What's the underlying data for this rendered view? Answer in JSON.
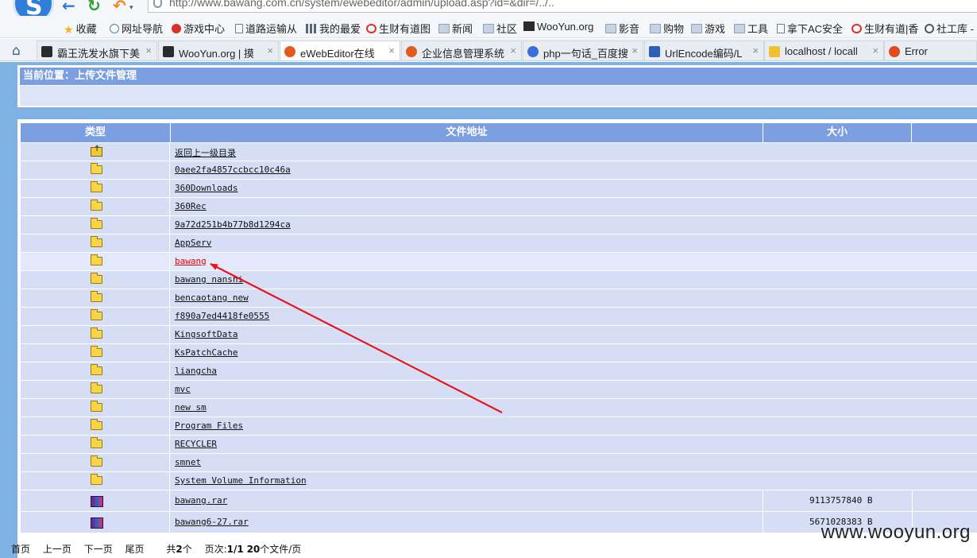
{
  "browser": {
    "logo_letter": "S",
    "url": "http://www.bawang.com.cn/system/ewebeditor/admin/upload.asp?id=&dir=/../..",
    "bookmarks": [
      {
        "label": "收藏",
        "icon": "star-icon"
      },
      {
        "label": "网址导航",
        "icon": "globe-icon"
      },
      {
        "label": "游戏中心",
        "icon": "game-icon"
      },
      {
        "label": "道路运输从",
        "icon": "page-icon"
      },
      {
        "label": "我的最爱",
        "icon": "grid-icon"
      },
      {
        "label": "生财有道图",
        "icon": "chrome-icon"
      },
      {
        "label": "新闻",
        "icon": "folder-icon"
      },
      {
        "label": "社区",
        "icon": "folder-icon"
      },
      {
        "label": "WooYun.org",
        "icon": "wooyun-icon"
      },
      {
        "label": "影音",
        "icon": "folder-icon"
      },
      {
        "label": "购物",
        "icon": "folder-icon"
      },
      {
        "label": "游戏",
        "icon": "folder-icon"
      },
      {
        "label": "工具",
        "icon": "folder-icon"
      },
      {
        "label": "拿下AC安全",
        "icon": "page-icon"
      },
      {
        "label": "生财有道|香",
        "icon": "chrome-icon"
      },
      {
        "label": "社工库 -",
        "icon": "search-icon"
      }
    ],
    "tabs": [
      {
        "label": "霸王洗发水旗下美",
        "icon": "dark"
      },
      {
        "label": "WooYun.org | 摸",
        "icon": "dark"
      },
      {
        "label": "eWebEditor在线",
        "icon": "red",
        "active": true
      },
      {
        "label": "企业信息管理系统",
        "icon": "red"
      },
      {
        "label": "php一句话_百度搜",
        "icon": "paw"
      },
      {
        "label": "UrlEncode编码/L",
        "icon": "uenc"
      },
      {
        "label": "localhost / locall",
        "icon": "pma"
      },
      {
        "label": "Error",
        "icon": "err"
      }
    ]
  },
  "location": {
    "title": "当前位置：上传文件管理"
  },
  "table": {
    "headers": {
      "type": "类型",
      "path": "文件地址",
      "size": "大小"
    },
    "rows": [
      {
        "kind": "up",
        "name": "返回上一级目录",
        "size": ""
      },
      {
        "kind": "folder",
        "name": "0aee2fa4857ccbcc10c46a",
        "size": ""
      },
      {
        "kind": "folder",
        "name": "360Downloads",
        "size": ""
      },
      {
        "kind": "folder",
        "name": "360Rec",
        "size": ""
      },
      {
        "kind": "folder",
        "name": "9a72d251b4b77b8d1294ca",
        "size": ""
      },
      {
        "kind": "folder",
        "name": "AppServ",
        "size": ""
      },
      {
        "kind": "folder",
        "name": "bawang",
        "size": "",
        "highlight": true
      },
      {
        "kind": "folder",
        "name": "bawang nanshi",
        "size": ""
      },
      {
        "kind": "folder",
        "name": "bencaotang new",
        "size": ""
      },
      {
        "kind": "folder",
        "name": "f890a7ed4418fe0555",
        "size": ""
      },
      {
        "kind": "folder",
        "name": "KingsoftData",
        "size": ""
      },
      {
        "kind": "folder",
        "name": "KsPatchCache",
        "size": ""
      },
      {
        "kind": "folder",
        "name": "liangcha",
        "size": ""
      },
      {
        "kind": "folder",
        "name": "mvc",
        "size": ""
      },
      {
        "kind": "folder",
        "name": "new sm",
        "size": ""
      },
      {
        "kind": "folder",
        "name": "Program Files",
        "size": ""
      },
      {
        "kind": "folder",
        "name": "RECYCLER",
        "size": ""
      },
      {
        "kind": "folder",
        "name": "smnet",
        "size": ""
      },
      {
        "kind": "folder",
        "name": "System Volume Information",
        "size": ""
      },
      {
        "kind": "rar",
        "name": "bawang.rar",
        "size": "9113757840 B"
      },
      {
        "kind": "rar",
        "name": "bawang6-27.rar",
        "size": "5671028383 B"
      }
    ]
  },
  "pagination": {
    "first": "首页",
    "prev": "上一页",
    "next": "下一页",
    "last": "尾页",
    "total_prefix": "共",
    "total_count": "2",
    "total_suffix": "个",
    "page_prefix": "页次:",
    "page_value": "1/1",
    "per_page_value": "20",
    "per_page_suffix": "个文件/页"
  },
  "annotation": {
    "color": "#e8141b"
  },
  "watermark": "www.wooyun.org"
}
